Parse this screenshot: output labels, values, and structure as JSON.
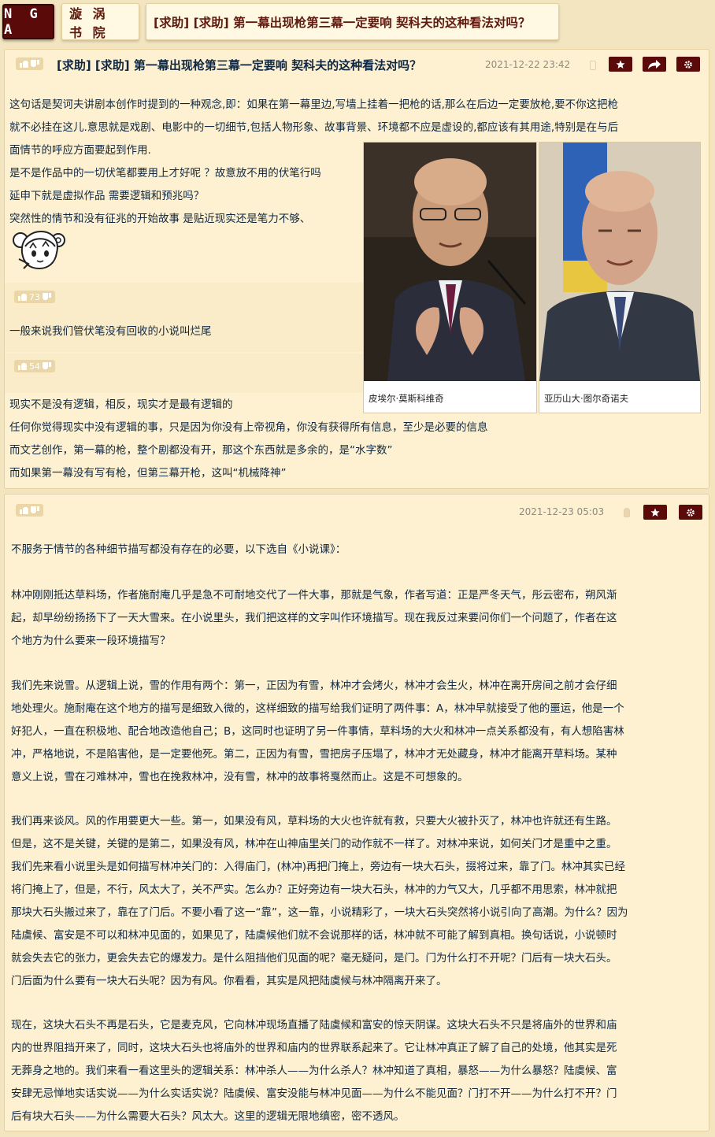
{
  "nav": {
    "logo": "N G A",
    "forum": "漩 涡 书 院",
    "topic": "[求助] [求助] 第一幕出现枪第三幕一定要响 契科夫的这种看法对吗？"
  },
  "post1": {
    "title": "[求助] [求助] 第一幕出现枪第三幕一定要响 契科夫的这种看法对吗？",
    "date": "2021-12-22 23:42",
    "lines": [
      "这句话是契诃夫讲剧本创作时提到的一种观念,即：如果在第一幕里边,写墙上挂着一把枪的话,那么在后边一定要放枪,要不你这把枪",
      "就不必挂在这儿.意思就是戏剧、电影中的一切细节,包括人物形象、故事背景、环境都不应是虚设的,都应该有其用途,特别是在与后",
      "面情节的呼应方面要起到作用.",
      "是不是作品中的一切伏笔都要用上才好呢 ？故意放不用的伏笔行吗",
      "延申下就是虚拟作品 需要逻辑和预兆吗？",
      "突然性的情节和没有征兆的开始故事 是贴近现实还是笔力不够、"
    ],
    "replies": [
      {
        "likes": "73",
        "text": "一般来说我们管伏笔没有回收的小说叫烂尾"
      },
      {
        "likes": "54",
        "lines": [
          "现实不是没有逻辑，相反，现实才是最有逻辑的",
          "任何你觉得现实中没有逻辑的事，只是因为你没有上帝视角，你没有获得所有信息，至少是必要的信息",
          "而文艺创作，第一幕的枪，整个剧都没有开，那这个东西就是多余的，是“水字数”",
          "而如果第一幕没有写有枪，但第三幕开枪，这叫“机械降神”"
        ]
      }
    ],
    "images": [
      {
        "caption": "皮埃尔·莫斯科维奇"
      },
      {
        "caption": "亚历山大·图尔奇诺夫"
      }
    ]
  },
  "post2": {
    "date": "2021-12-23 05:03",
    "intro": "不服务于情节的各种细节描写都没有存在的必要，以下选自《小说课》：",
    "p1": [
      "林冲刚刚抵达草料场，作者施耐庵几乎是急不可耐地交代了一件大事，那就是气象，作者写道：正是严冬天气，彤云密布，朔风渐",
      "起，却早纷纷扬扬下了一天大雪来。在小说里头，我们把这样的文字叫作环境描写。现在我反过来要问你们一个问题了，作者在这",
      "个地方为什么要来一段环境描写？"
    ],
    "p2": [
      "我们先来说雪。从逻辑上说，雪的作用有两个：第一，正因为有雪，林冲才会烤火，林冲才会生火，林冲在离开房间之前才会仔细",
      "地处理火。施耐庵在这个地方的描写是细致入微的，这样细致的描写给我们证明了两件事：A，林冲早就接受了他的噩运，他是一个",
      "好犯人，一直在积极地、配合地改造他自己；B，这同时也证明了另一件事情，草料场的大火和林冲一点关系都没有，有人想陷害林",
      "冲，严格地说，不是陷害他，是一定要他死。第二，正因为有雪，雪把房子压塌了，林冲才无处藏身，林冲才能离开草料场。某种",
      "意义上说，雪在刁难林冲，雪也在挽救林冲，没有雪，林冲的故事将戛然而止。这是不可想象的。"
    ],
    "p3": [
      "我们再来谈风。风的作用要更大一些。第一，如果没有风，草料场的大火也许就有救，只要大火被扑灭了，林冲也许就还有生路。",
      "但是，这不是关键，关键的是第二，如果没有风，林冲在山神庙里关门的动作就不一样了。对林冲来说，如何关门才是重中之重。",
      "我们先来看小说里头是如何描写林冲关门的：入得庙门，(林冲)再把门掩上，旁边有一块大石头，掇将过来，靠了门。林冲其实已经",
      "将门掩上了，但是，不行，风太大了，关不严实。怎么办？正好旁边有一块大石头，林冲的力气又大，几乎都不用思索，林冲就把",
      "那块大石头搬过来了，靠在了门后。不要小看了这一“靠”，这一靠，小说精彩了，一块大石头突然将小说引向了高潮。为什么？因为",
      "陆虞候、富安是不可以和林冲见面的，如果见了，陆虞候他们就不会说那样的话，林冲就不可能了解到真相。换句话说，小说顿时",
      "就会失去它的张力，更会失去它的爆发力。是什么阻挡他们见面的呢？毫无疑问，是门。门为什么打不开呢？门后有一块大石头。",
      "门后面为什么要有一块大石头呢？因为有风。你看看，其实是风把陆虞候与林冲隔离开来了。"
    ],
    "p4": [
      "现在，这块大石头不再是石头，它是麦克风，它向林冲现场直播了陆虞候和富安的惊天阴谋。这块大石头不只是将庙外的世界和庙",
      "内的世界阻挡开来了，同时，这块大石头也将庙外的世界和庙内的世界联系起来了。它让林冲真正了解了自己的处境，他其实是死",
      "无葬身之地的。我们来看一看这里头的逻辑关系：林冲杀人——为什么杀人？林冲知道了真相，暴怒——为什么暴怒？陆虞候、富",
      "安肆无忌惮地实话实说——为什么实话实说？陆虞候、富安没能与林冲见面——为什么不能见面？门打不开——为什么打不开？门",
      "后有块大石头——为什么需要大石头？风太大。这里的逻辑无限地缜密，密不透风。"
    ]
  },
  "icons": {
    "star": "star-icon",
    "share": "share-icon",
    "settings": "gear-icon"
  },
  "colors": {
    "page_bg": "#f3e5c0",
    "post_bg": "#fdf1d2",
    "accent": "#5b0a0a",
    "date": "#8d8a80"
  }
}
